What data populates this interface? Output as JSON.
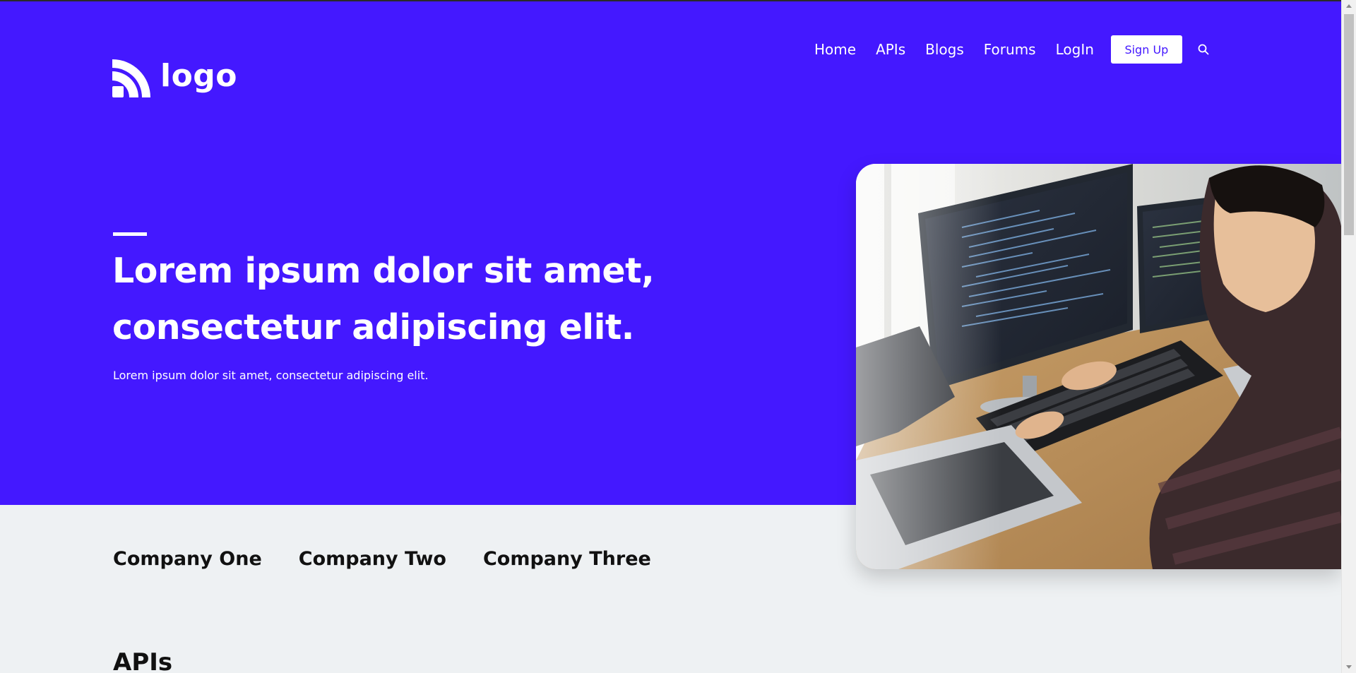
{
  "header": {
    "logo_text": "logo",
    "nav": [
      {
        "label": "Home"
      },
      {
        "label": "APIs"
      },
      {
        "label": "Blogs"
      },
      {
        "label": "Forums"
      },
      {
        "label": "LogIn"
      }
    ],
    "signup_label": "Sign Up",
    "search_icon": "search-icon"
  },
  "hero": {
    "headline_line1": "Lorem ipsum dolor sit amet,",
    "headline_line2": "consectetur adipiscing elit.",
    "subtext": "Lorem ipsum dolor sit amet, consectetur adipiscing elit.",
    "image_subject": "developer-at-computer-photo"
  },
  "companies": [
    {
      "name": "Company One"
    },
    {
      "name": "Company Two"
    },
    {
      "name": "Company Three"
    }
  ],
  "sections": {
    "apis_heading": "APIs"
  },
  "colors": {
    "brand": "#4418ff",
    "page_background": "#eef1f3",
    "text_dark": "#111111"
  }
}
